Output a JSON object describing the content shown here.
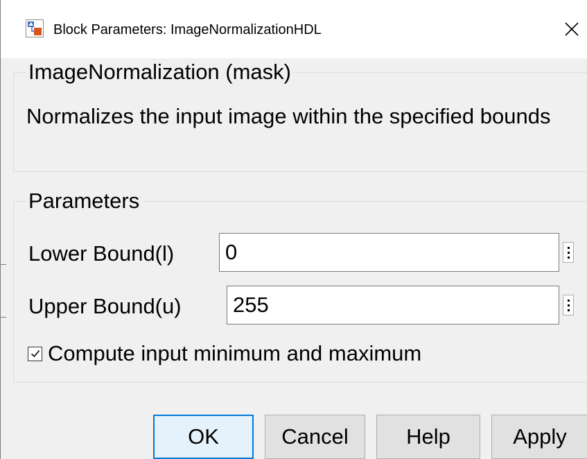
{
  "window": {
    "title": "Block Parameters: ImageNormalizationHDL",
    "close_icon": "close-icon"
  },
  "description_group": {
    "legend": "ImageNormalization (mask)",
    "text": "Normalizes the input image within the specified bounds"
  },
  "parameters_group": {
    "legend": "Parameters",
    "lower_bound": {
      "label": "Lower Bound(l)",
      "value": "0"
    },
    "upper_bound": {
      "label": "Upper Bound(u)",
      "value": "255"
    },
    "compute_minmax": {
      "label": "Compute input minimum and maximum",
      "checked": true
    }
  },
  "buttons": {
    "ok": "OK",
    "cancel": "Cancel",
    "help": "Help",
    "apply": "Apply"
  },
  "colors": {
    "dialog_bg": "#f0f0f0",
    "default_button_border": "#0078d7",
    "default_button_bg": "#e5f1fb"
  }
}
